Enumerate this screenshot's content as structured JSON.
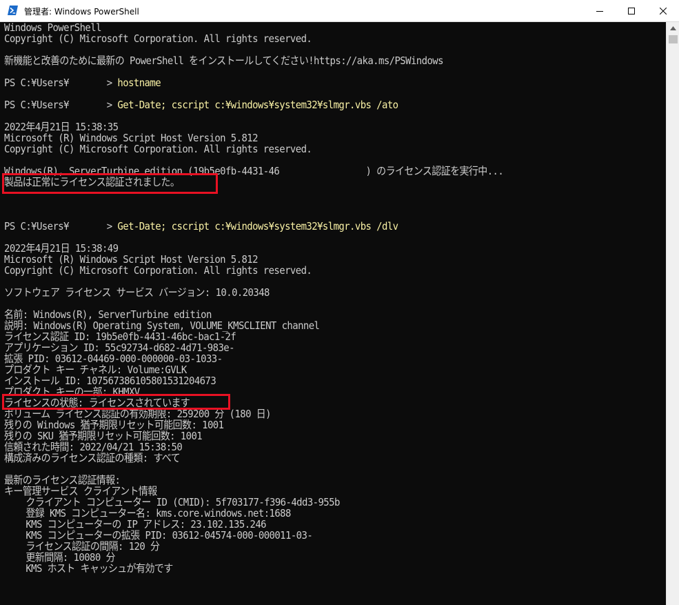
{
  "window": {
    "title": "管理者: Windows PowerShell",
    "minimize_glyph": "—",
    "maximize_glyph": "☐",
    "close_glyph": "✕",
    "icon": "powershell-icon",
    "accent_color": "#012456"
  },
  "console": {
    "foreground_color": "#cccccc",
    "command_color": "#f9f1a5",
    "background_color": "#0c0c0c",
    "highlight_color": "#e81123",
    "lines": [
      {
        "prompt": "",
        "text": "Windows PowerShell",
        "command": ""
      },
      {
        "prompt": "",
        "text": "Copyright (C) Microsoft Corporation. All rights reserved.",
        "command": ""
      },
      {
        "prompt": "",
        "text": "",
        "command": ""
      },
      {
        "prompt": "",
        "text": "新機能と改善のために最新の PowerShell をインストールしてください!https://aka.ms/PSWindows",
        "command": ""
      },
      {
        "prompt": "",
        "text": "",
        "command": ""
      },
      {
        "prompt": "PS C:¥Users¥       > ",
        "text": "",
        "command": "hostname"
      },
      {
        "prompt": "",
        "text": "",
        "command": ""
      },
      {
        "prompt": "PS C:¥Users¥       > ",
        "text": "",
        "command": "Get-Date; cscript c:¥windows¥system32¥slmgr.vbs /ato"
      },
      {
        "prompt": "",
        "text": "",
        "command": ""
      },
      {
        "prompt": "",
        "text": "2022年4月21日 15:38:35",
        "command": ""
      },
      {
        "prompt": "",
        "text": "Microsoft (R) Windows Script Host Version 5.812",
        "command": ""
      },
      {
        "prompt": "",
        "text": "Copyright (C) Microsoft Corporation. All rights reserved.",
        "command": ""
      },
      {
        "prompt": "",
        "text": "",
        "command": ""
      },
      {
        "prompt": "",
        "text": "Windows(R), ServerTurbine edition (19b5e0fb-4431-46                ) のライセンス認証を実行中...",
        "command": ""
      },
      {
        "prompt": "",
        "text": "製品は正常にライセンス認証されました。",
        "command": ""
      },
      {
        "prompt": "",
        "text": "",
        "command": ""
      },
      {
        "prompt": "",
        "text": "",
        "command": ""
      },
      {
        "prompt": "",
        "text": "",
        "command": ""
      },
      {
        "prompt": "PS C:¥Users¥       > ",
        "text": "",
        "command": "Get-Date; cscript c:¥windows¥system32¥slmgr.vbs /dlv"
      },
      {
        "prompt": "",
        "text": "",
        "command": ""
      },
      {
        "prompt": "",
        "text": "2022年4月21日 15:38:49",
        "command": ""
      },
      {
        "prompt": "",
        "text": "Microsoft (R) Windows Script Host Version 5.812",
        "command": ""
      },
      {
        "prompt": "",
        "text": "Copyright (C) Microsoft Corporation. All rights reserved.",
        "command": ""
      },
      {
        "prompt": "",
        "text": "",
        "command": ""
      },
      {
        "prompt": "",
        "text": "ソフトウェア ライセンス サービス バージョン: 10.0.20348",
        "command": ""
      },
      {
        "prompt": "",
        "text": "",
        "command": ""
      },
      {
        "prompt": "",
        "text": "名前: Windows(R), ServerTurbine edition",
        "command": ""
      },
      {
        "prompt": "",
        "text": "説明: Windows(R) Operating System, VOLUME_KMSCLIENT channel",
        "command": ""
      },
      {
        "prompt": "",
        "text": "ライセンス認証 ID: 19b5e0fb-4431-46bc-bac1-2f",
        "command": ""
      },
      {
        "prompt": "",
        "text": "アプリケーション ID: 55c92734-d682-4d71-983e-",
        "command": ""
      },
      {
        "prompt": "",
        "text": "拡張 PID: 03612-04469-000-000000-03-1033-",
        "command": ""
      },
      {
        "prompt": "",
        "text": "プロダクト キー チャネル: Volume:GVLK",
        "command": ""
      },
      {
        "prompt": "",
        "text": "インストール ID: 1075673861058015312046​73",
        "command": ""
      },
      {
        "prompt": "",
        "text": "プロダクト キーの一部: KHMXV",
        "command": ""
      },
      {
        "prompt": "",
        "text": "ライセンスの状態: ライセンスされています",
        "command": ""
      },
      {
        "prompt": "",
        "text": "ボリューム ライセンス認証の有効期限: 259200 分 (180 日)",
        "command": ""
      },
      {
        "prompt": "",
        "text": "残りの Windows 猶予期限リセット可能回数: 1001",
        "command": ""
      },
      {
        "prompt": "",
        "text": "残りの SKU 猶予期限リセット可能回数: 1001",
        "command": ""
      },
      {
        "prompt": "",
        "text": "信頼された時間: 2022/04/21 15:38:50",
        "command": ""
      },
      {
        "prompt": "",
        "text": "構成済みのライセンス認証の種類: すべて",
        "command": ""
      },
      {
        "prompt": "",
        "text": "",
        "command": ""
      },
      {
        "prompt": "",
        "text": "最新のライセンス認証情報:",
        "command": ""
      },
      {
        "prompt": "",
        "text": "キー管理サービス クライアント情報",
        "command": ""
      },
      {
        "prompt": "",
        "text": "    クライアント コンピューター ID (CMID): 5f703177-f396-4dd3-955b",
        "command": ""
      },
      {
        "prompt": "",
        "text": "    登録 KMS コンピューター名: kms.core.windows.net:1688",
        "command": ""
      },
      {
        "prompt": "",
        "text": "    KMS コンピューターの IP アドレス: 23.102.135.246",
        "command": ""
      },
      {
        "prompt": "",
        "text": "    KMS コンピューターの拡張 PID: 03612-04574-000-000011-03-",
        "command": ""
      },
      {
        "prompt": "",
        "text": "    ライセンス認証の間隔: 120 分",
        "command": ""
      },
      {
        "prompt": "",
        "text": "    更新間隔: 10080 分",
        "command": ""
      },
      {
        "prompt": "",
        "text": "    KMS ホスト キャッシュが有効です",
        "command": ""
      }
    ]
  },
  "scrollbar": {
    "up_arrow": "▲"
  }
}
